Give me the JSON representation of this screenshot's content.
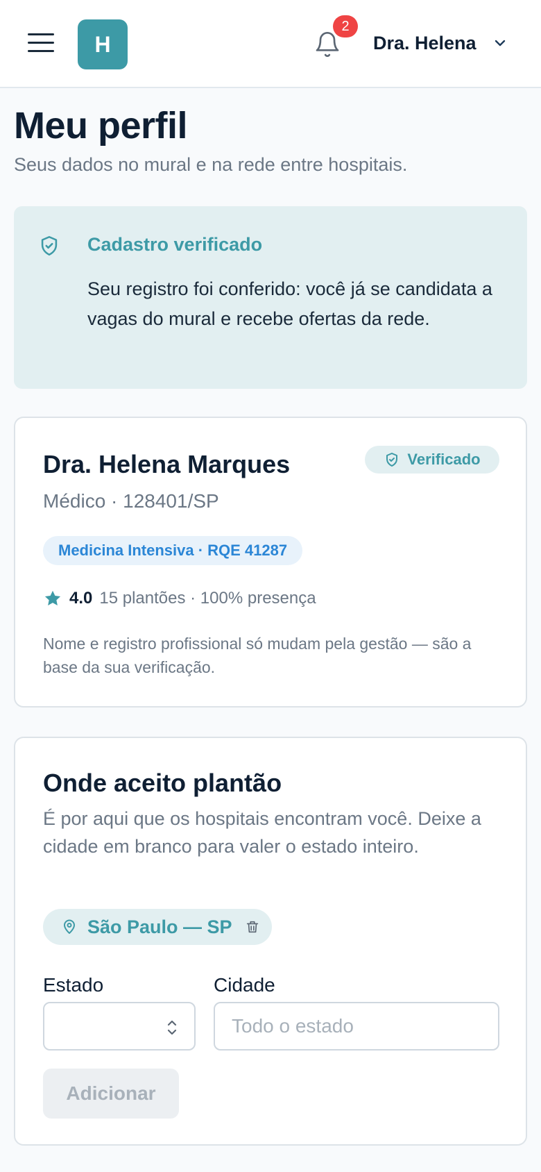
{
  "header": {
    "logo_letter": "H",
    "notifications_count": "2",
    "user_name": "Dra. Helena"
  },
  "page": {
    "title": "Meu perfil",
    "subtitle": "Seus dados no mural e na rede entre hospitais."
  },
  "banner": {
    "title": "Cadastro verificado",
    "text": "Seu registro foi conferido: você já se candidata a vagas do mural e recebe ofertas da rede."
  },
  "profile": {
    "name": "Dra. Helena Marques",
    "badge": "Verificado",
    "registration": "Médico · 128401/SP",
    "specialty": "Medicina Intensiva · RQE 41287",
    "rating": "4.0",
    "rating_meta": "15 plantões · 100% presença",
    "note": "Nome e registro profissional só mudam pela gestão — são a base da sua verificação."
  },
  "locations": {
    "title": "Onde aceito plantão",
    "description": "É por aqui que os hospitais encontram você. Deixe a cidade em branco para valer o estado inteiro.",
    "chips": [
      {
        "label": "São Paulo — SP"
      }
    ],
    "estado_label": "Estado",
    "estado_value": "",
    "cidade_label": "Cidade",
    "cidade_placeholder": "Todo o estado",
    "add_button": "Adicionar"
  },
  "icons": {
    "menu": "hamburger-menu-icon",
    "bell": "bell-icon",
    "chevron": "chevron-down-icon",
    "shield": "shield-check-icon",
    "star": "star-icon",
    "pin": "map-pin-icon",
    "trash": "trash-icon",
    "select": "chevron-up-down-icon"
  },
  "colors": {
    "accent": "#3d9aa6",
    "badge_red": "#ef4444",
    "specialty_blue": "#2b86d6",
    "banner_bg": "#e2eff1"
  }
}
